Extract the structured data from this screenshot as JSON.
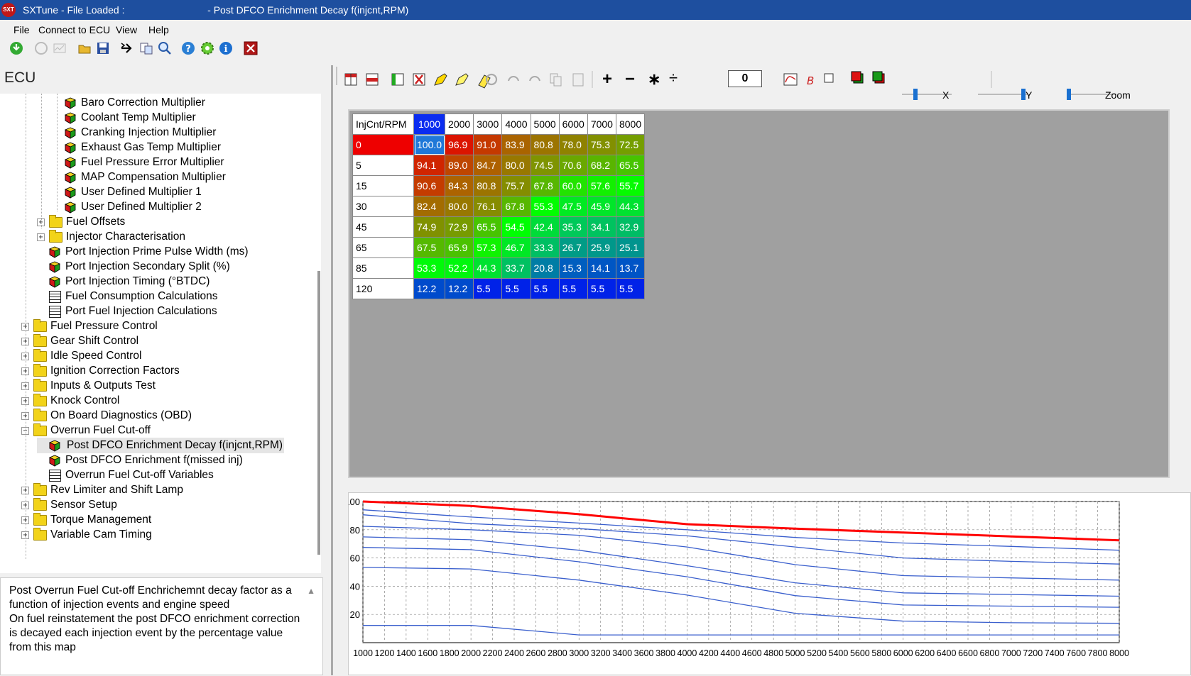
{
  "window": {
    "title": "SXTune - File Loaded :                              - Post DFCO Enrichment Decay f(injcnt,RPM)",
    "app_icon": "SXT"
  },
  "menu": [
    "File",
    "Connect to ECU",
    "View",
    "Help"
  ],
  "left": {
    "panel_title": "ECU",
    "tree": [
      {
        "label": "Baro Correction Multiplier",
        "icon": "cube",
        "level": 3
      },
      {
        "label": "Coolant Temp Multiplier",
        "icon": "cube",
        "level": 3
      },
      {
        "label": "Cranking Injection Multiplier",
        "icon": "cube",
        "level": 3
      },
      {
        "label": "Exhaust Gas Temp Multiplier",
        "icon": "cube",
        "level": 3
      },
      {
        "label": "Fuel Pressure Error Multiplier",
        "icon": "cube",
        "level": 3
      },
      {
        "label": "MAP Compensation Multiplier",
        "icon": "cube",
        "level": 3
      },
      {
        "label": "User Defined Multiplier 1",
        "icon": "cube",
        "level": 3
      },
      {
        "label": "User Defined Multiplier 2",
        "icon": "cube",
        "level": 3
      },
      {
        "label": "Fuel Offsets",
        "icon": "folder",
        "level": 2,
        "expander": "+"
      },
      {
        "label": "Injector Characterisation",
        "icon": "folder",
        "level": 2,
        "expander": "+"
      },
      {
        "label": "Port Injection Prime Pulse Width (ms)",
        "icon": "cube",
        "level": 2
      },
      {
        "label": "Port Injection Secondary Split (%)",
        "icon": "cube",
        "level": 2
      },
      {
        "label": "Port Injection Timing (°BTDC)",
        "icon": "cube",
        "level": 2
      },
      {
        "label": "Fuel Consumption Calculations",
        "icon": "grid",
        "level": 2
      },
      {
        "label": "Port Fuel Injection Calculations",
        "icon": "grid",
        "level": 2
      },
      {
        "label": "Fuel Pressure Control",
        "icon": "folder",
        "level": 1,
        "expander": "+"
      },
      {
        "label": "Gear Shift Control",
        "icon": "folder",
        "level": 1,
        "expander": "+"
      },
      {
        "label": "Idle Speed Control",
        "icon": "folder",
        "level": 1,
        "expander": "+"
      },
      {
        "label": "Ignition Correction Factors",
        "icon": "folder",
        "level": 1,
        "expander": "+"
      },
      {
        "label": "Inputs & Outputs Test",
        "icon": "folder",
        "level": 1,
        "expander": "+"
      },
      {
        "label": "Knock Control",
        "icon": "folder",
        "level": 1,
        "expander": "+"
      },
      {
        "label": "On Board Diagnostics (OBD)",
        "icon": "folder",
        "level": 1,
        "expander": "+"
      },
      {
        "label": "Overrun Fuel Cut-off",
        "icon": "folder",
        "level": 1,
        "expander": "−"
      },
      {
        "label": "Post DFCO Enrichment Decay f(injcnt,RPM)",
        "icon": "cube",
        "level": 2,
        "selected": true
      },
      {
        "label": "Post DFCO Enrichment f(missed inj)",
        "icon": "cube",
        "level": 2
      },
      {
        "label": "Overrun Fuel Cut-off Variables",
        "icon": "grid",
        "level": 2
      },
      {
        "label": "Rev Limiter and Shift Lamp",
        "icon": "folder",
        "level": 1,
        "expander": "+"
      },
      {
        "label": "Sensor Setup",
        "icon": "folder",
        "level": 1,
        "expander": "+"
      },
      {
        "label": "Torque Management",
        "icon": "folder",
        "level": 1,
        "expander": "+"
      },
      {
        "label": "Variable Cam Timing",
        "icon": "folder",
        "level": 1,
        "expander": "+"
      }
    ],
    "description": "Post Overrun Fuel Cut-off Enchrichemnt decay factor as a function of injection events and engine speed\nOn fuel reinstatement the post DFCO enrichment correction is decayed each injection event by the percentage value from this map"
  },
  "map_toolbar": {
    "op_value": "0",
    "x_label": "X",
    "y_label": "Y",
    "zoom_label": "Zoom",
    "ops": [
      "+",
      "−",
      "∗",
      "÷"
    ]
  },
  "table": {
    "corner": "InjCnt/RPM",
    "columns": [
      "1000",
      "2000",
      "3000",
      "4000",
      "5000",
      "6000",
      "7000",
      "8000"
    ],
    "rows": [
      {
        "label": "0",
        "values": [
          "100.0",
          "96.9",
          "91.0",
          "83.9",
          "80.8",
          "78.0",
          "75.3",
          "72.5"
        ]
      },
      {
        "label": "5",
        "values": [
          "94.1",
          "89.0",
          "84.7",
          "80.0",
          "74.5",
          "70.6",
          "68.2",
          "65.5"
        ]
      },
      {
        "label": "15",
        "values": [
          "90.6",
          "84.3",
          "80.8",
          "75.7",
          "67.8",
          "60.0",
          "57.6",
          "55.7"
        ]
      },
      {
        "label": "30",
        "values": [
          "82.4",
          "80.0",
          "76.1",
          "67.8",
          "55.3",
          "47.5",
          "45.9",
          "44.3"
        ]
      },
      {
        "label": "45",
        "values": [
          "74.9",
          "72.9",
          "65.5",
          "54.5",
          "42.4",
          "35.3",
          "34.1",
          "32.9"
        ]
      },
      {
        "label": "65",
        "values": [
          "67.5",
          "65.9",
          "57.3",
          "46.7",
          "33.3",
          "26.7",
          "25.9",
          "25.1"
        ]
      },
      {
        "label": "85",
        "values": [
          "53.3",
          "52.2",
          "44.3",
          "33.7",
          "20.8",
          "15.3",
          "14.1",
          "13.7"
        ]
      },
      {
        "label": "120",
        "values": [
          "12.2",
          "12.2",
          "5.5",
          "5.5",
          "5.5",
          "5.5",
          "5.5",
          "5.5"
        ]
      }
    ]
  },
  "chart_data": {
    "type": "line",
    "x": [
      1000,
      2000,
      3000,
      4000,
      5000,
      6000,
      7000,
      8000
    ],
    "xlim": [
      1000,
      8000
    ],
    "ylim": [
      0,
      100
    ],
    "x_ticks": [
      "1000",
      "1200",
      "1400",
      "1600",
      "1800",
      "2000",
      "2200",
      "2400",
      "2600",
      "2800",
      "3000",
      "3200",
      "3400",
      "3600",
      "3800",
      "4000",
      "4200",
      "4400",
      "4600",
      "4800",
      "5000",
      "5200",
      "5400",
      "5600",
      "5800",
      "6000",
      "6200",
      "6400",
      "6600",
      "6800",
      "7000",
      "7200",
      "7400",
      "7600",
      "7800",
      "8000"
    ],
    "y_ticks": [
      "100",
      "80",
      "60",
      "40",
      "20"
    ],
    "grid": true,
    "series": [
      {
        "values": [
          100.0,
          96.9,
          91.0,
          83.9,
          80.8,
          78.0,
          75.3,
          72.5
        ],
        "color": "#ff0000"
      },
      {
        "values": [
          94.1,
          89.0,
          84.7,
          80.0,
          74.5,
          70.6,
          68.2,
          65.5
        ],
        "color": "#3a5fcd"
      },
      {
        "values": [
          90.6,
          84.3,
          80.8,
          75.7,
          67.8,
          60.0,
          57.6,
          55.7
        ],
        "color": "#3a5fcd"
      },
      {
        "values": [
          82.4,
          80.0,
          76.1,
          67.8,
          55.3,
          47.5,
          45.9,
          44.3
        ],
        "color": "#3a5fcd"
      },
      {
        "values": [
          74.9,
          72.9,
          65.5,
          54.5,
          42.4,
          35.3,
          34.1,
          32.9
        ],
        "color": "#3a5fcd"
      },
      {
        "values": [
          67.5,
          65.9,
          57.3,
          46.7,
          33.3,
          26.7,
          25.9,
          25.1
        ],
        "color": "#3a5fcd"
      },
      {
        "values": [
          53.3,
          52.2,
          44.3,
          33.7,
          20.8,
          15.3,
          14.1,
          13.7
        ],
        "color": "#3a5fcd"
      },
      {
        "values": [
          12.2,
          12.2,
          5.5,
          5.5,
          5.5,
          5.5,
          5.5,
          5.5
        ],
        "color": "#3a5fcd"
      }
    ]
  }
}
